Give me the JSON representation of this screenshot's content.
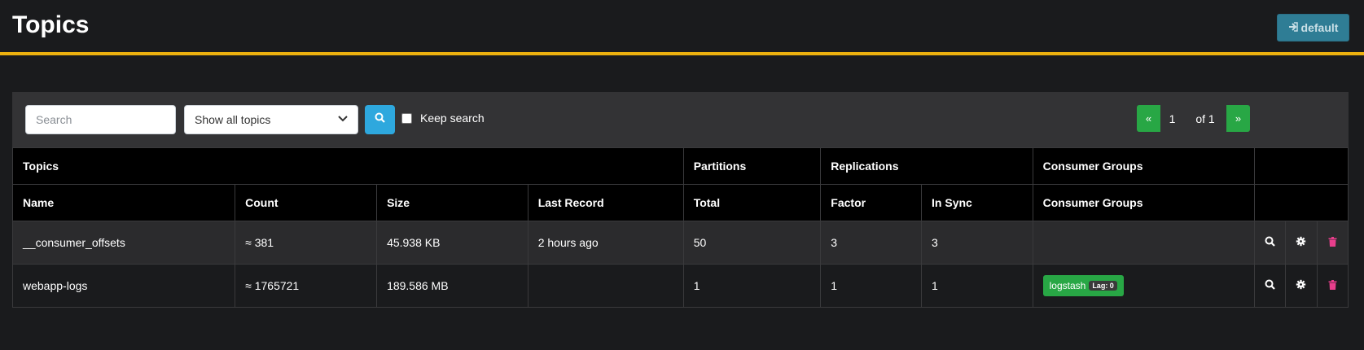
{
  "header": {
    "title": "Topics",
    "cluster_button": "default"
  },
  "toolbar": {
    "search_placeholder": "Search",
    "topic_filter": "Show all topics",
    "keep_search_label": "Keep search"
  },
  "pagination": {
    "prev": "«",
    "current_page": "1",
    "of_label": "of 1",
    "next": "»"
  },
  "table": {
    "group_headers": [
      "Topics",
      "Partitions",
      "Replications",
      "Consumer Groups",
      ""
    ],
    "columns": [
      "Name",
      "Count",
      "Size",
      "Last Record",
      "Total",
      "Factor",
      "In Sync",
      "Consumer Groups"
    ],
    "rows": [
      {
        "name": "__consumer_offsets",
        "count": "≈ 381",
        "size": "45.938 KB",
        "last_record": "2 hours ago",
        "total": "50",
        "factor": "3",
        "in_sync": "3",
        "consumer_group": "",
        "lag": ""
      },
      {
        "name": "webapp-logs",
        "count": "≈ 1765721",
        "size": "189.586 MB",
        "last_record": "",
        "total": "1",
        "factor": "1",
        "in_sync": "1",
        "consumer_group": "logstash",
        "lag": "Lag: 0"
      }
    ]
  },
  "colors": {
    "accent": "#ecb10f",
    "success": "#28a745",
    "info": "#2ea8de",
    "danger": "#e83e8c"
  },
  "icons": {
    "cluster": "sign-in-icon",
    "search": "search-icon",
    "view": "search-icon",
    "config": "gear-icon",
    "delete": "trash-icon"
  }
}
